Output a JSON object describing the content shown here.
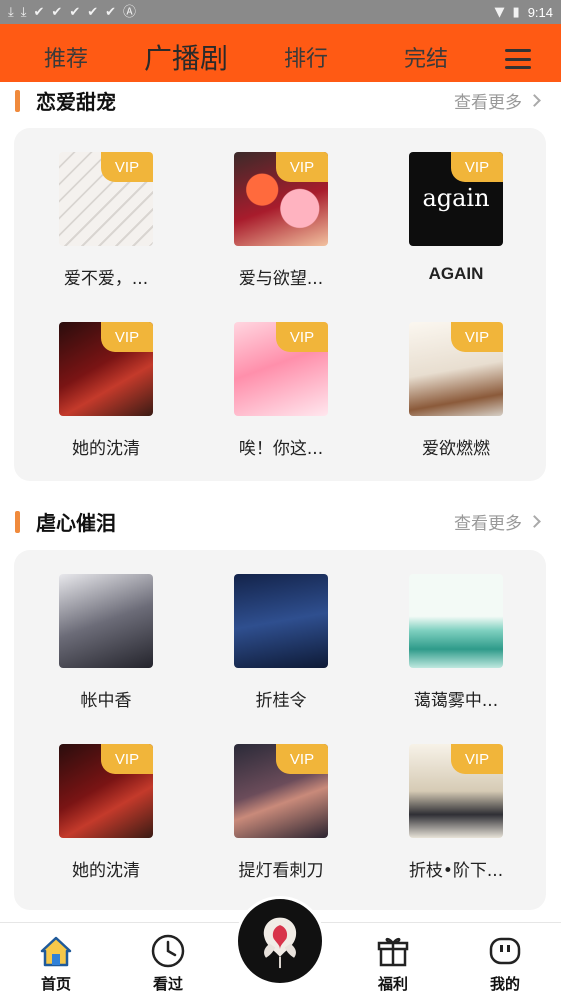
{
  "status_bar": {
    "left_icons": [
      "download-icon",
      "download-icon",
      "check-icon",
      "check-icon",
      "check-icon",
      "check-icon",
      "check-icon",
      "a-icon"
    ],
    "time": "9:14"
  },
  "top_nav": {
    "tabs": [
      "推荐",
      "广播剧",
      "排行",
      "完结"
    ],
    "active_tab": "广播剧",
    "color": "#ff5a14"
  },
  "sections": [
    {
      "title": "恋爱甜宠",
      "more_label": "查看更多",
      "items": [
        {
          "title": "爱不爱，...",
          "vip": "VIP"
        },
        {
          "title": "爱与欲望...",
          "vip": "VIP"
        },
        {
          "title": "AGAIN",
          "cover_text": "again",
          "vip": "VIP"
        },
        {
          "title": "她的沈清",
          "vip": "VIP"
        },
        {
          "title": "唉！你这...",
          "vip": "VIP"
        },
        {
          "title": "爱欲燃燃",
          "vip": "VIP"
        }
      ]
    },
    {
      "title": "虐心催泪",
      "more_label": "查看更多",
      "items": [
        {
          "title": "帐中香",
          "vip": ""
        },
        {
          "title": "折桂令",
          "vip": ""
        },
        {
          "title": "蔼蔼雾中...",
          "vip": ""
        },
        {
          "title": "她的沈清",
          "vip": "VIP"
        },
        {
          "title": "提灯看刺刀",
          "vip": "VIP"
        },
        {
          "title": "折枝•阶下...",
          "vip": "VIP"
        }
      ]
    }
  ],
  "bottom_nav": {
    "items": [
      {
        "label": "首页",
        "icon": "home-icon"
      },
      {
        "label": "看过",
        "icon": "clock-icon"
      },
      {
        "label": "福利",
        "icon": "gift-icon"
      },
      {
        "label": "我的",
        "icon": "profile-icon"
      }
    ],
    "center_icon": "rose-logo-icon"
  },
  "vip_color": "#f1b53a"
}
